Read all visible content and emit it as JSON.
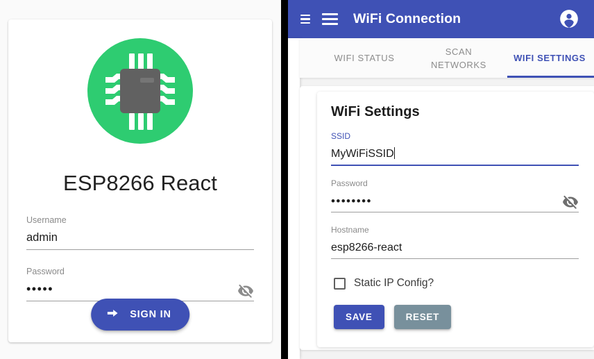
{
  "login": {
    "logo_icon": "chip-icon",
    "logo_bg_color": "#2ecc71",
    "logo_chip_color": "#616161",
    "app_title": "ESP8266 React",
    "username": {
      "label": "Username",
      "value": "admin"
    },
    "password": {
      "label": "Password",
      "value": "•••••",
      "toggle_icon": "eye-off-icon"
    },
    "signin_button": {
      "label": "SIGN IN",
      "icon": "arrow-right-icon",
      "color": "#3f51b5"
    }
  },
  "app": {
    "appbar": {
      "menu_icon_small": "menu-small-icon",
      "menu_icon": "hamburger-icon",
      "title": "WiFi Connection",
      "account_icon": "account-circle-icon",
      "color": "#3f51b5"
    },
    "tabs": [
      {
        "label": "WIFI STATUS",
        "active": false
      },
      {
        "label": "SCAN NETWORKS",
        "active": false
      },
      {
        "label": "WIFI SETTINGS",
        "active": true
      }
    ],
    "settings_card": {
      "title": "WiFi Settings",
      "ssid": {
        "label": "SSID",
        "value": "MyWiFiSSID",
        "focused": true
      },
      "password": {
        "label": "Password",
        "value": "••••••••",
        "toggle_icon": "eye-off-icon"
      },
      "hostname": {
        "label": "Hostname",
        "value": "esp8266-react"
      },
      "static_ip": {
        "label": "Static IP Config?",
        "checked": false
      },
      "save_button": {
        "label": "SAVE",
        "color": "#3f51b5"
      },
      "reset_button": {
        "label": "RESET",
        "color": "#78909c"
      }
    }
  }
}
